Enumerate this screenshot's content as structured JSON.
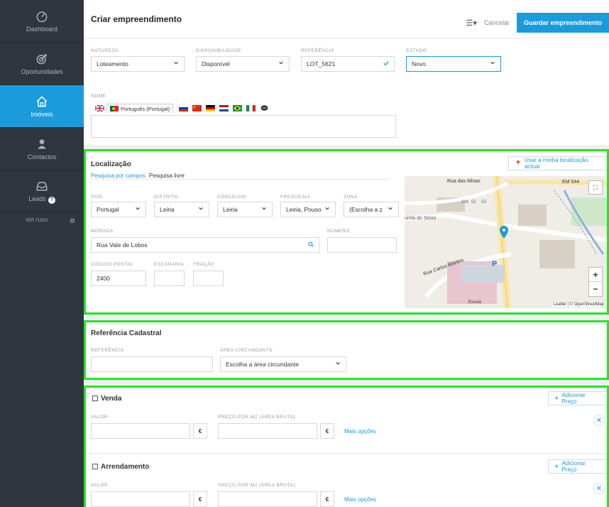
{
  "sidebar": {
    "items": [
      {
        "label": "Dashboard",
        "icon": "dashboard-icon"
      },
      {
        "label": "Oportunidades",
        "icon": "target-icon"
      },
      {
        "label": "Imóveis",
        "icon": "home-icon",
        "active": true
      },
      {
        "label": "Contactos",
        "icon": "person-icon"
      },
      {
        "label": "Leads",
        "icon": "inbox-icon",
        "badge": "?"
      }
    ],
    "ver_tudo": "VER TUDO"
  },
  "header": {
    "title": "Criar empreendimento",
    "cancel": "Cancelar",
    "save": "Guardar empreendimento"
  },
  "top_fields": {
    "natureza": {
      "label": "NATUREZA",
      "value": "Loteamento"
    },
    "disponibilidade": {
      "label": "DISPONIBILIDADE",
      "value": "Disponível"
    },
    "referencia": {
      "label": "REFERÊNCIA",
      "value": "LOT_5621"
    },
    "estado": {
      "label": "ESTADO",
      "value": "Novo"
    }
  },
  "nome": {
    "label": "NOME",
    "language": "Português (Portugal)"
  },
  "localizacao": {
    "title": "Localização",
    "use_location": "Usar a minha localização actual",
    "tabs": [
      "Pesquisa por campos",
      "Pesquisa livre"
    ],
    "pais": {
      "label": "PAÍS",
      "value": "Portugal"
    },
    "distrito": {
      "label": "DISTRITO",
      "value": "Leiria"
    },
    "concelho": {
      "label": "CONCELHO",
      "value": "Leiria"
    },
    "freguesia": {
      "label": "FREGUESIA",
      "value": "Leiria, Pouso"
    },
    "zona": {
      "label": "ZONA",
      "value": "(Escolha a z"
    },
    "morada": {
      "label": "MORADA",
      "value": "Rua Vale de Lobos"
    },
    "numero": {
      "label": "NÚMERO",
      "value": ""
    },
    "codigo_postal": {
      "label": "CÓDIGO POSTAL",
      "value": "2400"
    },
    "escadaria": {
      "label": "ESCADARIA",
      "value": ""
    },
    "fracao": {
      "label": "FRAÇÃO",
      "value": ""
    },
    "map": {
      "labels": [
        "Rua das Minas",
        "EM 544",
        "uinta do Seixo",
        "Rua Carlos Martins",
        "P",
        "Escola",
        "104",
        "52",
        "50"
      ],
      "attribution": "Leaflet | © OpenStreetMap",
      "zoom_in": "+",
      "zoom_out": "−"
    }
  },
  "cadastral": {
    "title": "Referência Cadastral",
    "referencia": {
      "label": "REFERÊNCIA",
      "value": ""
    },
    "area": {
      "label": "ÁREA CIRCUNDANTE",
      "value": "Escolha a área circundante"
    }
  },
  "venda": {
    "title": "Venda",
    "add_price": "Adicionar Preço",
    "valor": {
      "label": "VALOR",
      "value": ""
    },
    "preco_m2": {
      "label": "PREÇO POR M2 (ÁREA BRUTA)",
      "value": ""
    },
    "currency": "€",
    "more": "Mais opções"
  },
  "arrendamento": {
    "title": "Arrendamento",
    "add_price": "Adicionar Preço",
    "valor": {
      "label": "VALOR",
      "value": ""
    },
    "preco_m2": {
      "label": "PREÇO POR M2 (ÁREA BRUTA)",
      "value": ""
    },
    "currency": "€",
    "more": "Mais opções"
  },
  "colors": {
    "accent": "#1a9bdc",
    "sidebar": "#2f3640",
    "highlight": "#22e622"
  }
}
